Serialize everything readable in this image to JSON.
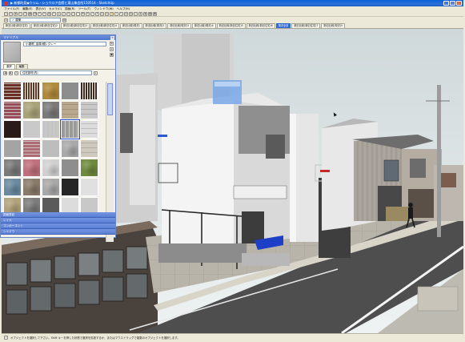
{
  "window": {
    "title": "▶ 新都町見◆ウリム - ショウロア会館と東山集会所150514 - SketchUp"
  },
  "menu": [
    "ファイル(F)",
    "編集(E)",
    "表示(V)",
    "カメラ(C)",
    "描画(R)",
    "ツール(T)",
    "ウィンドウ(W)",
    "ヘルプ(H)"
  ],
  "toolbar": {
    "icons": [
      "new-icon",
      "open-icon",
      "save-icon",
      "cut-icon",
      "copy-icon",
      "paste-icon",
      "erase-icon",
      "undo-icon",
      "redo-icon",
      "print-icon",
      "select-icon",
      "paint-icon",
      "line-icon",
      "rect-icon",
      "circle-icon",
      "arc-icon",
      "move-icon",
      "rotate-icon",
      "scale-icon",
      "pushpull-icon",
      "offset-icon",
      "orbit-icon",
      "pan-icon",
      "zoom-icon",
      "zoomext-icon",
      "section-icon",
      "xray-icon",
      "wire-icon",
      "hidden-icon",
      "shaded-icon",
      "texture-icon",
      "mono-icon"
    ],
    "layer_label": "✓ 建築"
  },
  "scenes": [
    "新旧比較(新旧住宅)",
    "新旧比較(新旧住宅)2",
    "新旧比較(新旧住宅)3",
    "新旧比較(新旧住宅)4",
    "新旧比較(現況)",
    "新旧比較(現況)2",
    "新旧比較(現況)3",
    "新旧比較(現況)4",
    "新旧比較(新旧住宅)5",
    "新旧比較(新旧住宅)6",
    "現況全景",
    "新旧比較(新旧住宅)7",
    "新旧比較(現況)5"
  ],
  "active_scene_index": 10,
  "active_scene_label": "現況全景",
  "materials_panel": {
    "title": "マテリアル",
    "close_label": "×",
    "material_name": "小屋根_金属(銀)-グレー",
    "tabs": [
      "選択",
      "編集"
    ],
    "active_tab": 0,
    "library": "住宅部材(内)",
    "textures": [
      {
        "color": "#6b2e24",
        "pattern": "brick"
      },
      {
        "color": "#5a3a26",
        "pattern": "wood"
      },
      {
        "color": "#b08a3c",
        "pattern": "noise"
      },
      {
        "color": "#8d8d8d",
        "pattern": "plain"
      },
      {
        "color": "#3a2a22",
        "pattern": "wood"
      },
      {
        "color": "#9a4c5a",
        "pattern": "brick"
      },
      {
        "color": "#a9a37a",
        "pattern": "noise"
      },
      {
        "color": "#7a7a7a",
        "pattern": "noise"
      },
      {
        "color": "#b9a88e",
        "pattern": "tile"
      },
      {
        "color": "#c8c8c8",
        "pattern": "tile"
      },
      {
        "color": "#2a1a18",
        "pattern": "plain"
      },
      {
        "color": "#c9c9c9",
        "pattern": "plain"
      },
      {
        "color": "#c5c5c5",
        "pattern": "lines"
      },
      {
        "color": "#9a9a9a",
        "pattern": "lines"
      },
      {
        "color": "#dcdcdc",
        "pattern": "tile"
      },
      {
        "color": "#a4a4a4",
        "pattern": "plain"
      },
      {
        "color": "#b06a73",
        "pattern": "brick"
      },
      {
        "color": "#bdbdbd",
        "pattern": "plain"
      },
      {
        "color": "#a9a9a9",
        "pattern": "noise"
      },
      {
        "color": "#cfc9bd",
        "pattern": "tile"
      },
      {
        "color": "#7a7a7a",
        "pattern": "noise"
      },
      {
        "color": "#c0707c",
        "pattern": "noise"
      },
      {
        "color": "#d0d0d0",
        "pattern": "noise"
      },
      {
        "color": "#8e8e8e",
        "pattern": "plain"
      },
      {
        "color": "#6e8a3e",
        "pattern": "noise"
      },
      {
        "color": "#6a8aa0",
        "pattern": "noise"
      },
      {
        "color": "#8a7a6a",
        "pattern": "noise"
      },
      {
        "color": "#a8a8a8",
        "pattern": "noise"
      },
      {
        "color": "#262626",
        "pattern": "plain"
      },
      {
        "color": "#e0e0e0",
        "pattern": "plain"
      },
      {
        "color": "#b1a27a",
        "pattern": "noise"
      },
      {
        "color": "#7c7c7c",
        "pattern": "noise"
      },
      {
        "color": "#5a5a5a",
        "pattern": "plain"
      },
      {
        "color": "#dcdcdc",
        "pattern": "plain"
      },
      {
        "color": "#c8c8c8",
        "pattern": "plain"
      }
    ],
    "sections": [
      "図面表記",
      "レイヤ",
      "コンポーネント",
      "シャドウ"
    ]
  },
  "status": {
    "text": "オブジェクトを選択して下さい。Shift キーを押した状態で選択を拡張するか、またはマウスドラッグで複数のオブジェクトを選択します。"
  },
  "colors": {
    "sky": "#dfe6e8",
    "road": "#4e4e4e",
    "accent": "#2f6bd1"
  }
}
